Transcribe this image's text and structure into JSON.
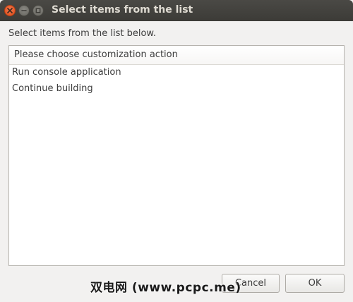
{
  "window": {
    "title": "Select items from the list"
  },
  "dialog": {
    "prompt": "Select items from the list below.",
    "list": {
      "header": "Please choose customization action",
      "items": [
        {
          "label": "Run console application"
        },
        {
          "label": "Continue building"
        }
      ]
    },
    "buttons": {
      "cancel": "Cancel",
      "ok": "OK"
    }
  },
  "watermark": "双电网 (www.pcpc.me)",
  "icons": {
    "close": "close-icon",
    "minimize": "minimize-icon",
    "maximize": "maximize-icon"
  },
  "colors": {
    "titlebar": "#3c3b37",
    "close_button": "#df4a16",
    "background": "#f2f1f0"
  }
}
